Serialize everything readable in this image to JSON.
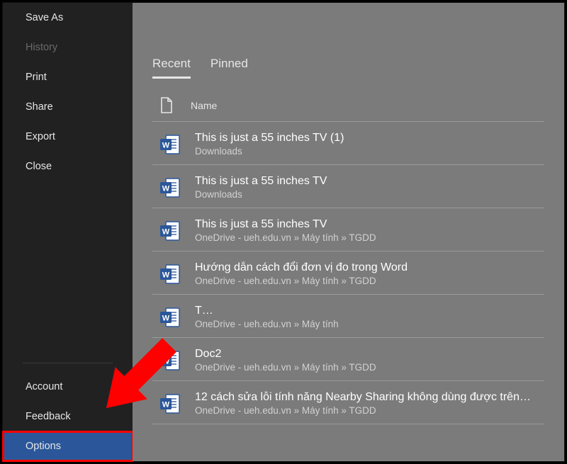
{
  "sidebar": {
    "top": [
      {
        "label": "Save As",
        "disabled": false
      },
      {
        "label": "History",
        "disabled": true
      },
      {
        "label": "Print",
        "disabled": false
      },
      {
        "label": "Share",
        "disabled": false
      },
      {
        "label": "Export",
        "disabled": false
      },
      {
        "label": "Close",
        "disabled": false
      }
    ],
    "bottom": [
      {
        "label": "Account"
      },
      {
        "label": "Feedback"
      },
      {
        "label": "Options"
      }
    ]
  },
  "tabs": {
    "recent": "Recent",
    "pinned": "Pinned",
    "active": "recent"
  },
  "columns": {
    "name": "Name"
  },
  "files": [
    {
      "title": "This is just a 55 inches TV (1)",
      "path": "Downloads"
    },
    {
      "title": "This is just a 55 inches TV",
      "path": "Downloads"
    },
    {
      "title": "This is just a 55 inches TV",
      "path": "OneDrive - ueh.edu.vn » Máy tính » TGDD"
    },
    {
      "title": "Hướng dẫn cách đổi đơn vị đo trong Word",
      "path": "OneDrive - ueh.edu.vn » Máy tính » TGDD"
    },
    {
      "title": "T…",
      "path": "OneDrive - ueh.edu.vn » Máy tính"
    },
    {
      "title": "Doc2",
      "path": "OneDrive - ueh.edu.vn » Máy tính » TGDD"
    },
    {
      "title": "12 cách sửa lỗi tính năng Nearby Sharing không dùng được trên…",
      "path": "OneDrive - ueh.edu.vn » Máy tính » TGDD"
    }
  ]
}
